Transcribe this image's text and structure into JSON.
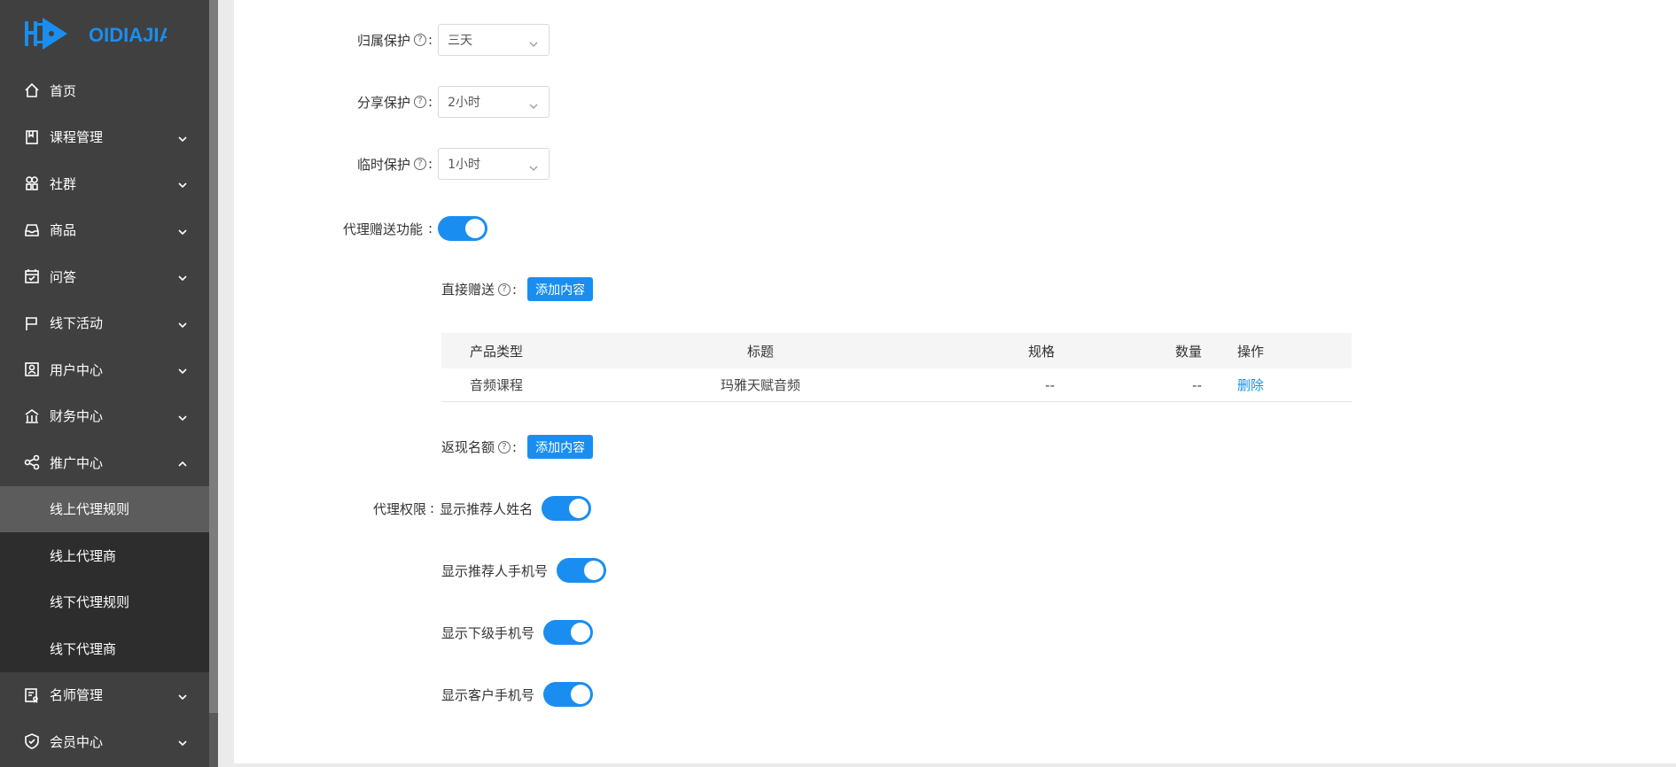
{
  "sidebar": {
    "brand": "OIDIAJIA",
    "items": [
      {
        "label": "首页",
        "icon": "home-icon"
      },
      {
        "label": "课程管理",
        "icon": "book-icon"
      },
      {
        "label": "社群",
        "icon": "community-icon"
      },
      {
        "label": "商品",
        "icon": "inbox-icon"
      },
      {
        "label": "问答",
        "icon": "calendar-icon"
      },
      {
        "label": "线下活动",
        "icon": "flag-icon"
      },
      {
        "label": "用户中心",
        "icon": "user-card-icon"
      },
      {
        "label": "财务中心",
        "icon": "bank-icon"
      },
      {
        "label": "推广中心",
        "icon": "share-icon"
      }
    ],
    "sub_items": [
      "线上代理规则",
      "线上代理商",
      "线下代理规则",
      "线下代理商"
    ],
    "after_items": [
      {
        "label": "名师管理",
        "icon": "teacher-icon"
      },
      {
        "label": "会员中心",
        "icon": "shield-check-icon"
      }
    ]
  },
  "form": {
    "ownership_protect": {
      "label": "归属保护",
      "value": "三天"
    },
    "share_protect": {
      "label": "分享保护",
      "value": "2小时"
    },
    "temp_protect": {
      "label": "临时保护",
      "value": "1小时"
    },
    "gift_feature": {
      "label": "代理赠送功能",
      "on": true
    },
    "direct_gift": {
      "label": "直接赠送",
      "button": "添加内容"
    },
    "table": {
      "headers": [
        "产品类型",
        "标题",
        "规格",
        "数量",
        "操作"
      ],
      "rows": [
        [
          "音频课程",
          "玛雅天赋音频",
          "--",
          "--",
          "删除"
        ]
      ]
    },
    "cashback": {
      "label": "返现名额",
      "button": "添加内容"
    },
    "permissions": {
      "label": "代理权限",
      "items": [
        {
          "label": "显示推荐人姓名",
          "on": true
        },
        {
          "label": "显示推荐人手机号",
          "on": true
        },
        {
          "label": "显示下级手机号",
          "on": true
        },
        {
          "label": "显示客户手机号",
          "on": true
        }
      ]
    }
  },
  "colors": {
    "accent": "#1a8ef0",
    "sidebar_bg": "#404040",
    "submenu_bg": "#2d2d2d",
    "submenu_active": "#5c5c5c"
  }
}
